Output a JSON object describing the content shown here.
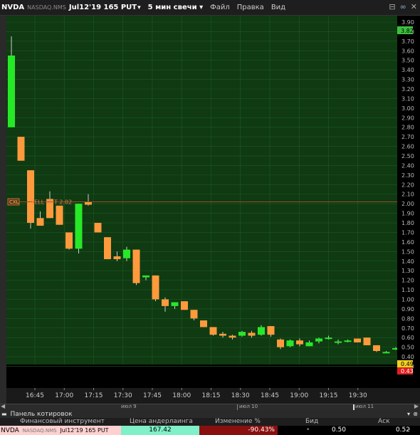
{
  "titlebar": {
    "symbol": "NVDA",
    "exchange": "NASDAQ.NMS",
    "contract": "Jul12'19 165 PUT",
    "timeframe": "5 мин свечи",
    "menus": [
      "Файл",
      "Правка",
      "Вид"
    ]
  },
  "order_line": {
    "tag": "CXL",
    "label": "SELL LMT 2.02",
    "price": 2.02
  },
  "price_tags": {
    "top": "3.82",
    "last": "0.49",
    "bid": "0.43"
  },
  "navigator": {
    "day_labels": [
      "июл 9",
      "июл 10",
      "июл 11"
    ]
  },
  "quote_panel": {
    "title": "Панель котировок",
    "columns": [
      "Финансовый инструмент",
      "Цена андерлаинга",
      "Изменение %",
      "Бид",
      "Аск"
    ],
    "row": {
      "symbol": "NVDA",
      "exchange": "NASDAQ.NMS",
      "contract": "Jul12'19 165 PUT",
      "underlying_price": "167.42",
      "change_pct": "-90.43%",
      "bid": "0.50",
      "ask": "0.52"
    }
  },
  "colors": {
    "up": "#27e827",
    "down": "#ff9a3c",
    "chart_bg": "#0f3a12",
    "grid": "#1e5a22",
    "order_line": "#a04a2a"
  },
  "chart_data": {
    "type": "candlestick",
    "title": "",
    "ylim": [
      0.25,
      3.95
    ],
    "y_ticks": [
      "3.90",
      "3.80",
      "3.70",
      "3.60",
      "3.50",
      "3.40",
      "3.30",
      "3.20",
      "3.10",
      "3.00",
      "2.90",
      "2.80",
      "2.70",
      "2.60",
      "2.50",
      "2.40",
      "2.30",
      "2.20",
      "2.10",
      "2.00",
      "1.90",
      "1.80",
      "1.70",
      "1.60",
      "1.50",
      "1.40",
      "1.30",
      "1.20",
      "1.10",
      "1.00",
      "0.90",
      "0.80",
      "0.70",
      "0.60",
      "0.50",
      "0.40",
      "0.30"
    ],
    "x_ticks": [
      "16:45",
      "17:00",
      "17:15",
      "17:30",
      "17:45",
      "18:00",
      "18:15",
      "18:30",
      "18:45",
      "19:00",
      "19:15",
      "19:30"
    ],
    "candles": [
      {
        "o": 2.8,
        "h": 3.75,
        "l": 2.8,
        "c": 3.55
      },
      {
        "o": 2.7,
        "h": 2.7,
        "l": 2.45,
        "c": 2.45
      },
      {
        "o": 2.35,
        "h": 2.35,
        "l": 1.74,
        "c": 1.8
      },
      {
        "o": 1.85,
        "h": 1.92,
        "l": 1.77,
        "c": 1.77
      },
      {
        "o": 2.05,
        "h": 2.13,
        "l": 1.85,
        "c": 1.85
      },
      {
        "o": 1.98,
        "h": 1.98,
        "l": 1.78,
        "c": 1.78
      },
      {
        "o": 1.7,
        "h": 1.7,
        "l": 1.52,
        "c": 1.53
      },
      {
        "o": 1.53,
        "h": 2.0,
        "l": 1.48,
        "c": 2.0
      },
      {
        "o": 2.02,
        "h": 2.1,
        "l": 1.98,
        "c": 1.99
      },
      {
        "o": 1.8,
        "h": 1.8,
        "l": 1.7,
        "c": 1.7
      },
      {
        "o": 1.65,
        "h": 1.65,
        "l": 1.42,
        "c": 1.42
      },
      {
        "o": 1.45,
        "h": 1.5,
        "l": 1.4,
        "c": 1.42
      },
      {
        "o": 1.43,
        "h": 1.55,
        "l": 1.4,
        "c": 1.52
      },
      {
        "o": 1.52,
        "h": 1.52,
        "l": 1.15,
        "c": 1.17
      },
      {
        "o": 1.23,
        "h": 1.25,
        "l": 1.2,
        "c": 1.25
      },
      {
        "o": 1.25,
        "h": 1.25,
        "l": 0.98,
        "c": 1.0
      },
      {
        "o": 1.0,
        "h": 1.02,
        "l": 0.87,
        "c": 0.93
      },
      {
        "o": 0.93,
        "h": 0.97,
        "l": 0.9,
        "c": 0.97
      },
      {
        "o": 0.98,
        "h": 0.98,
        "l": 0.89,
        "c": 0.89
      },
      {
        "o": 0.89,
        "h": 0.89,
        "l": 0.78,
        "c": 0.8
      },
      {
        "o": 0.78,
        "h": 0.78,
        "l": 0.71,
        "c": 0.71
      },
      {
        "o": 0.71,
        "h": 0.71,
        "l": 0.62,
        "c": 0.63
      },
      {
        "o": 0.64,
        "h": 0.66,
        "l": 0.6,
        "c": 0.62
      },
      {
        "o": 0.62,
        "h": 0.63,
        "l": 0.58,
        "c": 0.6
      },
      {
        "o": 0.62,
        "h": 0.67,
        "l": 0.61,
        "c": 0.66
      },
      {
        "o": 0.65,
        "h": 0.67,
        "l": 0.6,
        "c": 0.62
      },
      {
        "o": 0.63,
        "h": 0.73,
        "l": 0.62,
        "c": 0.71
      },
      {
        "o": 0.72,
        "h": 0.72,
        "l": 0.61,
        "c": 0.63
      },
      {
        "o": 0.58,
        "h": 0.59,
        "l": 0.48,
        "c": 0.5
      },
      {
        "o": 0.51,
        "h": 0.58,
        "l": 0.5,
        "c": 0.57
      },
      {
        "o": 0.57,
        "h": 0.59,
        "l": 0.51,
        "c": 0.53
      },
      {
        "o": 0.51,
        "h": 0.57,
        "l": 0.51,
        "c": 0.55
      },
      {
        "o": 0.56,
        "h": 0.6,
        "l": 0.54,
        "c": 0.59
      },
      {
        "o": 0.6,
        "h": 0.62,
        "l": 0.58,
        "c": 0.6
      },
      {
        "o": 0.55,
        "h": 0.58,
        "l": 0.53,
        "c": 0.56
      },
      {
        "o": 0.56,
        "h": 0.58,
        "l": 0.55,
        "c": 0.57
      },
      {
        "o": 0.59,
        "h": 0.59,
        "l": 0.55,
        "c": 0.55
      },
      {
        "o": 0.6,
        "h": 0.6,
        "l": 0.52,
        "c": 0.52
      },
      {
        "o": 0.52,
        "h": 0.52,
        "l": 0.45,
        "c": 0.46
      },
      {
        "o": 0.45,
        "h": 0.46,
        "l": 0.44,
        "c": 0.45
      },
      {
        "o": 0.48,
        "h": 0.5,
        "l": 0.47,
        "c": 0.49
      }
    ]
  }
}
